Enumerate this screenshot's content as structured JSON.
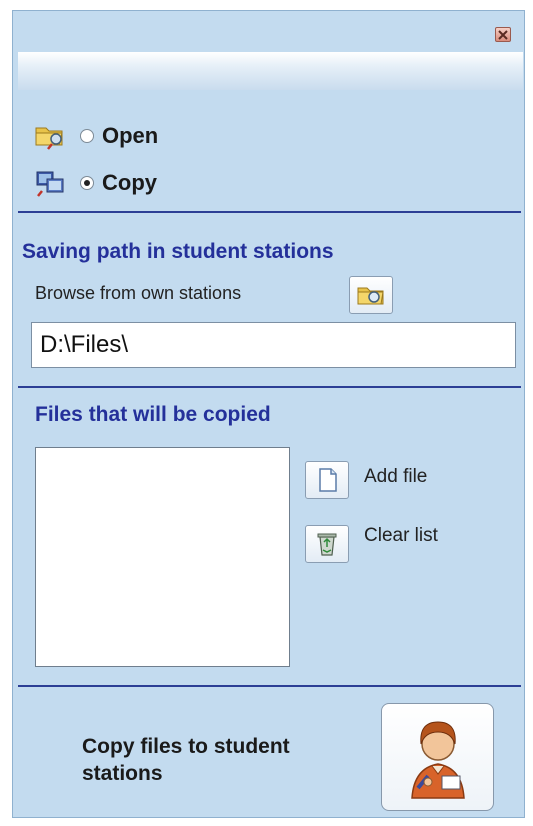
{
  "window": {
    "close_icon": "close-icon"
  },
  "mode": {
    "options": [
      {
        "label": "Open",
        "selected": false,
        "icon": "open-folder-icon"
      },
      {
        "label": "Copy",
        "selected": true,
        "icon": "copy-computer-icon"
      }
    ]
  },
  "saving_path": {
    "title": "Saving path in student stations",
    "browse_label": "Browse from own stations",
    "browse_icon": "folder-search-icon",
    "value": "D:\\Files\\"
  },
  "files": {
    "title": "Files that will be copied",
    "items": [],
    "add_label": "Add file",
    "add_icon": "blank-page-icon",
    "clear_label": "Clear list",
    "clear_icon": "recycle-bin-icon"
  },
  "action": {
    "label_line1": "Copy files to student",
    "label_line2": "stations",
    "icon": "student-icon"
  },
  "colors": {
    "panel_bg": "#c3dbef",
    "accent": "#2c3f95",
    "title_text": "#24309a"
  }
}
